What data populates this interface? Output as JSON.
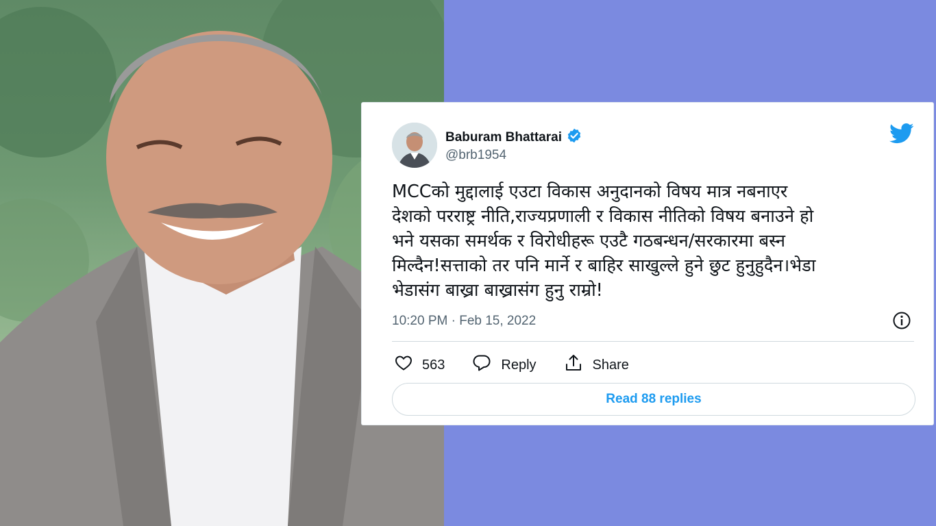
{
  "tweet": {
    "author_name": "Baburam Bhattarai",
    "handle": "@brb1954",
    "text": "MCCको मुद्दालाई एउटा विकास अनुदानको विषय मात्र नबनाएर\nदेशको परराष्ट्र नीति,राज्यप्रणाली र विकास नीतिको विषय बनाउने हो\nभने यसका समर्थक र विरोधीहरू एउटै गठबन्धन/सरकारमा बस्न\nमिल्दैन!सत्ताको तर पनि मार्ने र बाहिर साखुल्ले हुने छुट हुनुहुदैन।भेडा\nभेडासंग बाख्रा बाख्रासंग हुनु राम्रो!",
    "timestamp": "10:20 PM · Feb 15, 2022",
    "likes": "563",
    "reply_label": "Reply",
    "share_label": "Share",
    "read_replies": "Read 88 replies"
  },
  "colors": {
    "background": "#7b8ae0",
    "twitter_blue": "#1d9bf0",
    "text_primary": "#0f1419",
    "text_secondary": "#536471"
  },
  "icons": [
    "verified-badge-icon",
    "twitter-bird-icon",
    "info-icon",
    "heart-icon",
    "reply-icon",
    "share-icon"
  ]
}
